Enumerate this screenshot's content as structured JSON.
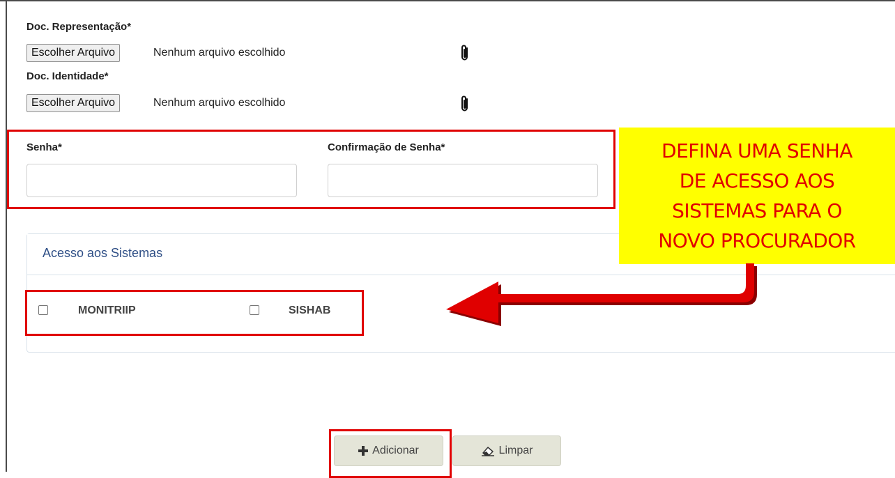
{
  "form": {
    "doc_representacao": {
      "label": "Doc. Representação*",
      "button_label": "Escolher Arquivo",
      "status": "Nenhum arquivo escolhido"
    },
    "doc_identidade": {
      "label": "Doc. Identidade*",
      "button_label": "Escolher Arquivo",
      "status": "Nenhum arquivo escolhido"
    },
    "senha": {
      "label": "Senha*",
      "value": ""
    },
    "confirmacao_senha": {
      "label": "Confirmação de Senha*",
      "value": ""
    }
  },
  "acesso_sistemas": {
    "title": "Acesso aos Sistemas",
    "systems": [
      {
        "label": "MONITRIIP",
        "checked": false
      },
      {
        "label": "SISHAB",
        "checked": false
      }
    ]
  },
  "actions": {
    "add_label": "Adicionar",
    "clear_label": "Limpar"
  },
  "callout": {
    "lines": [
      "DEFINA UMA SENHA",
      "DE ACESSO AOS",
      "SISTEMAS PARA O",
      "NOVO PROCURADOR"
    ]
  },
  "colors": {
    "highlight": "#e00000",
    "callout_bg": "#ffff00",
    "panel_title": "#2f4f86",
    "button_bg": "#e4e5d8"
  },
  "icons": {
    "attach": "paperclip-icon",
    "add": "plus-icon",
    "clear": "eraser-icon"
  }
}
